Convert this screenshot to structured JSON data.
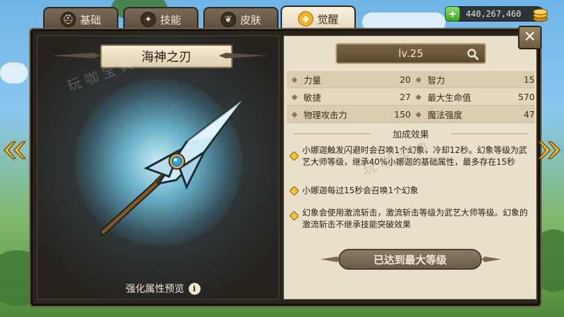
{
  "tabs": [
    {
      "label": "基础",
      "icon": "helmet-icon",
      "active": false
    },
    {
      "label": "技能",
      "icon": "skill-icon",
      "active": false
    },
    {
      "label": "皮肤",
      "icon": "skin-icon",
      "active": false
    },
    {
      "label": "觉醒",
      "icon": "awaken-icon",
      "active": true
    }
  ],
  "currency": {
    "amount": "440,267,460",
    "icon": "gold-coins-icon"
  },
  "weapon": {
    "name": "海神之刃",
    "preview_label": "强化属性预览",
    "watermark": "玩 咖 宝 典"
  },
  "level": {
    "label": "lv.25"
  },
  "stats": [
    {
      "left_name": "力量",
      "left_value": "20",
      "right_name": "智力",
      "right_value": "15"
    },
    {
      "left_name": "敏捷",
      "left_value": "27",
      "right_name": "最大生命值",
      "right_value": "570"
    },
    {
      "left_name": "物理攻击力",
      "left_value": "150",
      "right_name": "魔法强度",
      "right_value": "47"
    }
  ],
  "effects_header": "加成效果",
  "effects": [
    {
      "text": "小娜迦触发闪避时会召唤1个幻象，冷却12秒。幻象等级为武艺大师等级，继承40%小娜迦的基础属性，最多存在15秒"
    },
    {
      "text": "小娜迦每过15秒会召唤1个幻象"
    },
    {
      "text": "幻象会使用激流斩击，激流斩击等级为武艺大师等级。幻象的激流斩击不继承技能突破效果"
    }
  ],
  "max_level_label": "已达到最大等级",
  "colors": {
    "accent": "#f2b22a",
    "panel": "#e9dfca",
    "frame": "#2a241e"
  }
}
